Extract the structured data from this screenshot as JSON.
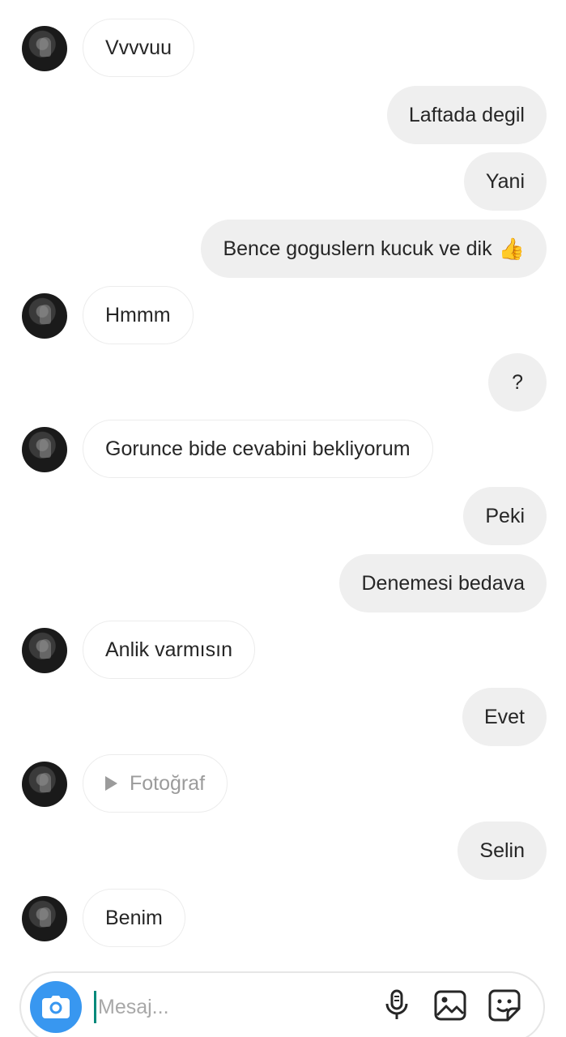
{
  "messages": [
    {
      "side": "in",
      "text": "Vvvvuu"
    },
    {
      "side": "out",
      "text": "Laftada degil"
    },
    {
      "side": "out",
      "text": "Yani"
    },
    {
      "side": "out",
      "text": "Bence goguslern kucuk ve dik",
      "emoji": "👍"
    },
    {
      "side": "in",
      "text": "Hmmm"
    },
    {
      "side": "out",
      "text": "?"
    },
    {
      "side": "in",
      "text": "Gorunce bide cevabini bekliyorum"
    },
    {
      "side": "out",
      "text": "Peki"
    },
    {
      "side": "out",
      "text": "Denemesi bedava"
    },
    {
      "side": "in",
      "text": "Anlik varmısın"
    },
    {
      "side": "out",
      "text": "Evet"
    },
    {
      "side": "in",
      "text": "Fotoğraf",
      "media": true
    },
    {
      "side": "out",
      "text": "Selin"
    },
    {
      "side": "in",
      "text": "Benim"
    }
  ],
  "composer": {
    "placeholder": "Mesaj...",
    "value": ""
  },
  "icons": {
    "camera": "camera-icon",
    "mic": "microphone-icon",
    "gallery": "gallery-icon",
    "sticker": "sticker-icon"
  },
  "colors": {
    "accent": "#3897f0",
    "incoming_bubble": "#ffffff",
    "outgoing_bubble": "#efefef",
    "text": "#262626",
    "muted": "#9b9b9b"
  }
}
